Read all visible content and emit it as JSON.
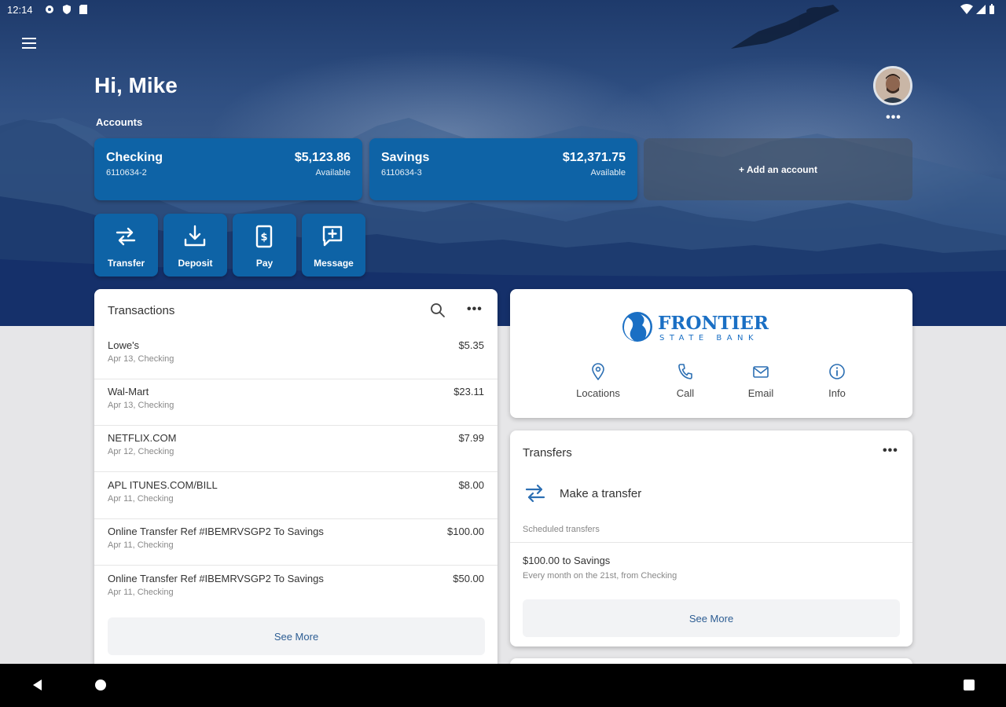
{
  "status_bar": {
    "time": "12:14"
  },
  "header": {
    "greeting": "Hi, Mike",
    "accounts_label": "Accounts",
    "accounts_more": "•••"
  },
  "accounts": [
    {
      "name": "Checking",
      "number": "6110634-2",
      "balance": "$5,123.86",
      "balance_label": "Available"
    },
    {
      "name": "Savings",
      "number": "6110634-3",
      "balance": "$12,371.75",
      "balance_label": "Available"
    }
  ],
  "add_account_label": "+ Add an account",
  "actions": [
    {
      "label": "Transfer",
      "icon": "transfer-icon"
    },
    {
      "label": "Deposit",
      "icon": "deposit-icon"
    },
    {
      "label": "Pay",
      "icon": "pay-icon"
    },
    {
      "label": "Message",
      "icon": "message-icon"
    }
  ],
  "transactions": {
    "title": "Transactions",
    "more": "•••",
    "items": [
      {
        "description": "Lowe's",
        "sub": "Apr 13, Checking",
        "amount": "$5.35"
      },
      {
        "description": "Wal-Mart",
        "sub": "Apr 13, Checking",
        "amount": "$23.11"
      },
      {
        "description": "NETFLIX.COM",
        "sub": "Apr 12, Checking",
        "amount": "$7.99"
      },
      {
        "description": "APL ITUNES.COM/BILL",
        "sub": "Apr 11, Checking",
        "amount": "$8.00"
      },
      {
        "description": "Online Transfer Ref #IBEMRVSGP2 To Savings",
        "sub": "Apr 11, Checking",
        "amount": "$100.00"
      },
      {
        "description": "Online Transfer Ref #IBEMRVSGP2 To Savings",
        "sub": "Apr 11, Checking",
        "amount": "$50.00"
      }
    ],
    "see_more": "See More"
  },
  "bank": {
    "name_line1": "FRONTIER",
    "name_line2": "STATE BANK",
    "brand_color": "#1a6fc4",
    "quick_links": [
      {
        "label": "Locations",
        "icon": "location-pin-icon"
      },
      {
        "label": "Call",
        "icon": "phone-icon"
      },
      {
        "label": "Email",
        "icon": "email-icon"
      },
      {
        "label": "Info",
        "icon": "info-icon"
      }
    ]
  },
  "transfers": {
    "title": "Transfers",
    "more": "•••",
    "make_transfer": "Make a transfer",
    "scheduled_label": "Scheduled transfers",
    "scheduled": [
      {
        "title": "$100.00 to Savings",
        "sub": "Every month on the 21st, from Checking"
      }
    ],
    "see_more": "See More"
  },
  "colors": {
    "primary": "#0e63a6",
    "link": "#2d5d93",
    "icon_blue": "#2c6fb3"
  }
}
